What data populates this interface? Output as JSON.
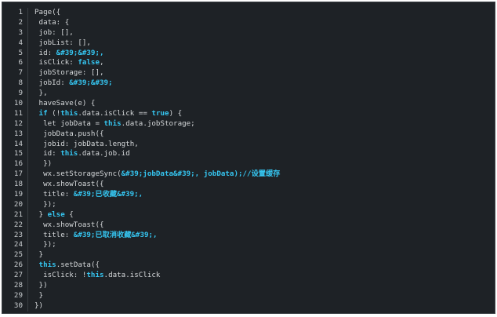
{
  "editor": {
    "lines": [
      {
        "n": "1",
        "tokens": [
          {
            "t": "Page({",
            "c": "plain"
          }
        ]
      },
      {
        "n": "2",
        "tokens": [
          {
            "t": " data: {",
            "c": "plain"
          }
        ]
      },
      {
        "n": "3",
        "tokens": [
          {
            "t": " job: [],",
            "c": "plain"
          }
        ]
      },
      {
        "n": "4",
        "tokens": [
          {
            "t": " jobList: [],",
            "c": "plain"
          }
        ]
      },
      {
        "n": "5",
        "tokens": [
          {
            "t": " id: ",
            "c": "plain"
          },
          {
            "t": "&#39;&#39;,",
            "c": "str"
          }
        ]
      },
      {
        "n": "6",
        "tokens": [
          {
            "t": " isClick: ",
            "c": "plain"
          },
          {
            "t": "false",
            "c": "kw"
          },
          {
            "t": ",",
            "c": "plain"
          }
        ]
      },
      {
        "n": "7",
        "tokens": [
          {
            "t": " jobStorage: [],",
            "c": "plain"
          }
        ]
      },
      {
        "n": "8",
        "tokens": [
          {
            "t": " jobId: ",
            "c": "plain"
          },
          {
            "t": "&#39;&#39;",
            "c": "str"
          }
        ]
      },
      {
        "n": "9",
        "tokens": [
          {
            "t": " },",
            "c": "plain"
          }
        ]
      },
      {
        "n": "10",
        "tokens": [
          {
            "t": " haveSave(e) {",
            "c": "plain"
          }
        ]
      },
      {
        "n": "11",
        "tokens": [
          {
            "t": " ",
            "c": "plain"
          },
          {
            "t": "if",
            "c": "kw"
          },
          {
            "t": " (!",
            "c": "plain"
          },
          {
            "t": "this",
            "c": "kw"
          },
          {
            "t": ".data.isClick == ",
            "c": "plain"
          },
          {
            "t": "true",
            "c": "kw"
          },
          {
            "t": ") {",
            "c": "plain"
          }
        ]
      },
      {
        "n": "12",
        "tokens": [
          {
            "t": "  let jobData = ",
            "c": "plain"
          },
          {
            "t": "this",
            "c": "kw"
          },
          {
            "t": ".data.jobStorage;",
            "c": "plain"
          }
        ]
      },
      {
        "n": "13",
        "tokens": [
          {
            "t": "  jobData.push({",
            "c": "plain"
          }
        ]
      },
      {
        "n": "14",
        "tokens": [
          {
            "t": "  jobid: jobData.length,",
            "c": "plain"
          }
        ]
      },
      {
        "n": "15",
        "tokens": [
          {
            "t": "  id: ",
            "c": "plain"
          },
          {
            "t": "this",
            "c": "kw"
          },
          {
            "t": ".data.job.id",
            "c": "plain"
          }
        ]
      },
      {
        "n": "16",
        "tokens": [
          {
            "t": "  })",
            "c": "plain"
          }
        ]
      },
      {
        "n": "17",
        "tokens": [
          {
            "t": "  wx.setStorageSync(",
            "c": "plain"
          },
          {
            "t": "&#39;jobData&#39;, jobData);//设置缓存",
            "c": "comment"
          }
        ]
      },
      {
        "n": "18",
        "tokens": [
          {
            "t": "  wx.showToast({",
            "c": "plain"
          }
        ]
      },
      {
        "n": "19",
        "tokens": [
          {
            "t": "  title: ",
            "c": "plain"
          },
          {
            "t": "&#39;已收藏&#39;,",
            "c": "str"
          }
        ]
      },
      {
        "n": "20",
        "tokens": [
          {
            "t": "  });",
            "c": "plain"
          }
        ]
      },
      {
        "n": "21",
        "tokens": [
          {
            "t": " } ",
            "c": "plain"
          },
          {
            "t": "else",
            "c": "kw"
          },
          {
            "t": " {",
            "c": "plain"
          }
        ]
      },
      {
        "n": "22",
        "tokens": [
          {
            "t": "  wx.showToast({",
            "c": "plain"
          }
        ]
      },
      {
        "n": "23",
        "tokens": [
          {
            "t": "  title: ",
            "c": "plain"
          },
          {
            "t": "&#39;已取消收藏&#39;,",
            "c": "str"
          }
        ]
      },
      {
        "n": "24",
        "tokens": [
          {
            "t": "  });",
            "c": "plain"
          }
        ]
      },
      {
        "n": "25",
        "tokens": [
          {
            "t": " }",
            "c": "plain"
          }
        ]
      },
      {
        "n": "26",
        "tokens": [
          {
            "t": " ",
            "c": "plain"
          },
          {
            "t": "this",
            "c": "kw"
          },
          {
            "t": ".setData({",
            "c": "plain"
          }
        ]
      },
      {
        "n": "27",
        "tokens": [
          {
            "t": "  isClick: !",
            "c": "plain"
          },
          {
            "t": "this",
            "c": "kw"
          },
          {
            "t": ".data.isClick",
            "c": "plain"
          }
        ]
      },
      {
        "n": "28",
        "tokens": [
          {
            "t": " })",
            "c": "plain"
          }
        ]
      },
      {
        "n": "29",
        "tokens": [
          {
            "t": " }",
            "c": "plain"
          }
        ]
      },
      {
        "n": "30",
        "tokens": [
          {
            "t": "})",
            "c": "plain"
          }
        ]
      }
    ]
  },
  "colors": {
    "background": "#1e2226",
    "keyword": "#35c5f0",
    "plain": "#d4d7d9",
    "gutter": "#c9cdd0"
  }
}
